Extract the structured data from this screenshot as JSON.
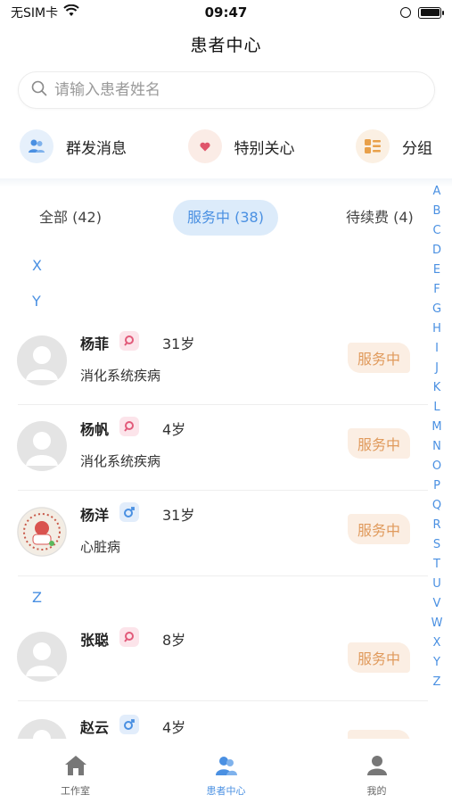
{
  "status_bar": {
    "carrier": "无SIM卡",
    "time": "09:47"
  },
  "header": {
    "title": "患者中心"
  },
  "search": {
    "placeholder": "请输入患者姓名"
  },
  "quick_actions": [
    {
      "label": "群发消息",
      "icon": "group-message-icon"
    },
    {
      "label": "特别关心",
      "icon": "heart-icon"
    },
    {
      "label": "分组",
      "icon": "group-list-icon"
    }
  ],
  "tabs": [
    {
      "label": "全部 (42)",
      "active": false
    },
    {
      "label": "服务中 (38)",
      "active": true
    },
    {
      "label": "待续费 (4)",
      "active": false
    }
  ],
  "index_letters": [
    "A",
    "B",
    "C",
    "D",
    "E",
    "F",
    "G",
    "H",
    "I",
    "J",
    "K",
    "L",
    "M",
    "N",
    "O",
    "P",
    "Q",
    "R",
    "S",
    "T",
    "U",
    "V",
    "W",
    "X",
    "Y",
    "Z"
  ],
  "sections": [
    {
      "letter": "X",
      "patients": []
    },
    {
      "letter": "Y",
      "patients": [
        {
          "name": "杨菲",
          "gender": "female",
          "age": "31岁",
          "disease": "消化系统疾病",
          "status": "服务中",
          "avatar": "default"
        },
        {
          "name": "杨帆",
          "gender": "female",
          "age": "4岁",
          "disease": "消化系统疾病",
          "status": "服务中",
          "avatar": "default"
        },
        {
          "name": "杨洋",
          "gender": "male",
          "age": "31岁",
          "disease": "心脏病",
          "status": "服务中",
          "avatar": "photo"
        }
      ]
    },
    {
      "letter": "Z",
      "patients": [
        {
          "name": "张聪",
          "gender": "female",
          "age": "8岁",
          "disease": "",
          "status": "服务中",
          "avatar": "default"
        },
        {
          "name": "赵云",
          "gender": "male",
          "age": "4岁",
          "disease": "",
          "status": "",
          "avatar": "default"
        }
      ]
    }
  ],
  "bottom_nav": [
    {
      "label": "工作室",
      "icon": "home-icon",
      "active": false
    },
    {
      "label": "患者中心",
      "icon": "patients-icon",
      "active": true
    },
    {
      "label": "我的",
      "icon": "profile-icon",
      "active": false
    }
  ],
  "colors": {
    "accent": "#4a90e2",
    "female_badge": "#e25a7a",
    "male_badge": "#4a90e2",
    "status_tag_bg": "#fbeee3",
    "status_tag_text": "#e09a5c"
  }
}
